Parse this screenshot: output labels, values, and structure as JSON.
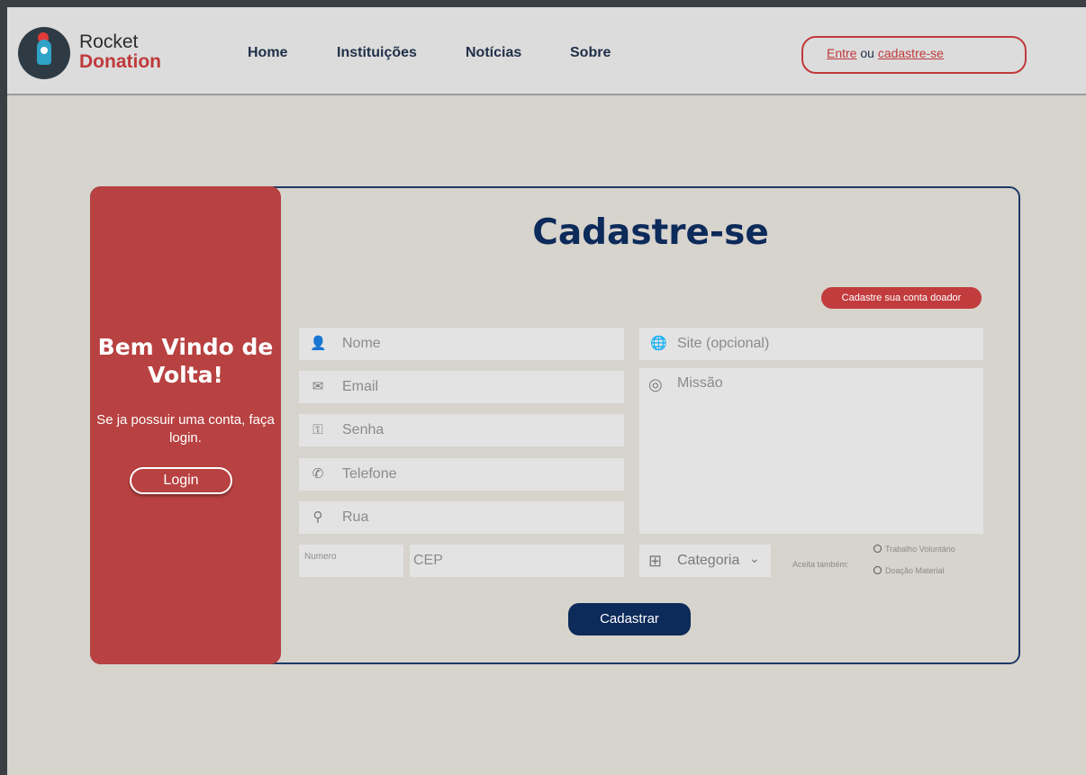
{
  "header": {
    "brand_line1": "Rocket",
    "brand_line2": "Donation",
    "nav": [
      "Home",
      "Instituições",
      "Notícias",
      "Sobre"
    ],
    "auth": {
      "login": "Entre",
      "separator": "ou",
      "signup": "cadastre-se"
    }
  },
  "side": {
    "title": "Bem Vindo de Volta!",
    "text": "Se ja possuir uma conta, faça login.",
    "login_button": "Login"
  },
  "form": {
    "title": "Cadastre-se",
    "donor_button": "Cadastre sua conta doador",
    "fields": {
      "nome": "Nome",
      "email": "Email",
      "senha": "Senha",
      "telefone": "Telefone",
      "rua": "Rua",
      "numero": "Numero",
      "cep": "CEP",
      "site": "Site (opcional)",
      "missao": "Missão",
      "categoria": "Categoria"
    },
    "accepts_label": "Aceita também:",
    "options": [
      "Trabalho Voluntário",
      "Doação Material"
    ],
    "submit": "Cadastrar"
  },
  "icons": {
    "user": "user-icon",
    "email": "envelope-icon",
    "key": "key-icon",
    "phone": "phone-icon",
    "location": "map-pin-icon",
    "globe": "globe-icon",
    "target": "target-icon",
    "grid": "grid-icon",
    "chevron": "chevron-down-icon"
  },
  "colors": {
    "accent_red": "#c0393b",
    "navy": "#0c2a5a",
    "sidebar": "#b84141"
  }
}
